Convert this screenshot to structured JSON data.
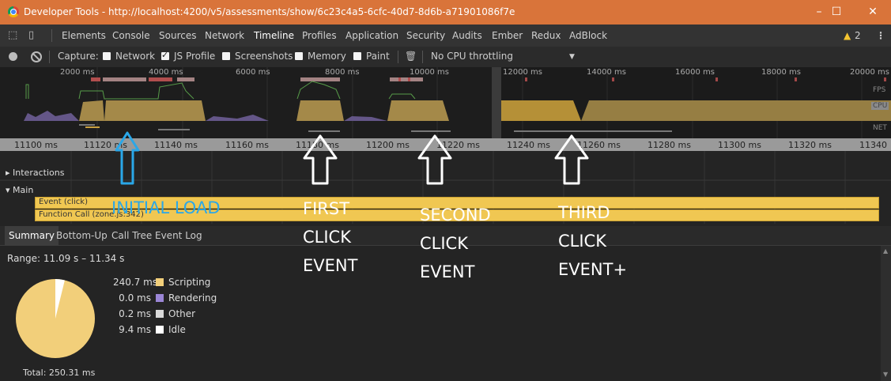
{
  "window": {
    "title": "Developer Tools - http://localhost:4200/v5/assessments/show/6c23c4a5-6cfc-40d7-8d6b-a71901086f7e",
    "controls": [
      "–",
      "☐",
      "✕"
    ]
  },
  "tabs": [
    "Elements",
    "Console",
    "Sources",
    "Network",
    "Timeline",
    "Profiles",
    "Application",
    "Security",
    "Audits",
    "Ember",
    "Redux",
    "AdBlock"
  ],
  "active_tab": "Timeline",
  "warnings": {
    "count": "2"
  },
  "toolbar": {
    "capture_label": "Capture:",
    "options": [
      {
        "label": "Network",
        "checked": false
      },
      {
        "label": "JS Profile",
        "checked": true
      },
      {
        "label": "Screenshots",
        "checked": false
      },
      {
        "label": "Memory",
        "checked": false
      },
      {
        "label": "Paint",
        "checked": false
      }
    ],
    "throttling": "No CPU throttling"
  },
  "overview": {
    "ticks": [
      "2000 ms",
      "4000 ms",
      "6000 ms",
      "8000 ms",
      "10000 ms",
      "12000 ms",
      "14000 ms",
      "16000 ms",
      "18000 ms",
      "20000 ms"
    ],
    "labels": {
      "fps": "FPS",
      "cpu": "CPU",
      "net": "NET"
    }
  },
  "ruler": {
    "ticks": [
      "11100 ms",
      "11120 ms",
      "11140 ms",
      "11160 ms",
      "11180 ms",
      "11200 ms",
      "11220 ms",
      "11240 ms",
      "11260 ms",
      "11280 ms",
      "11300 ms",
      "11320 ms",
      "11340"
    ]
  },
  "flame": {
    "interactions": "Interactions",
    "main": "Main",
    "event": "Event (click)",
    "function_call": "Function Call (zone.js:342)"
  },
  "bottom_tabs": [
    "Summary",
    "Bottom-Up",
    "Call Tree",
    "Event Log"
  ],
  "summary": {
    "range": "Range: 11.09 s – 11.34 s",
    "items": [
      {
        "value": "240.7 ms",
        "label": "Scripting",
        "color": "#f2cf7a"
      },
      {
        "value": "0.0 ms",
        "label": "Rendering",
        "color": "#9b86d6"
      },
      {
        "value": "0.2 ms",
        "label": "Other",
        "color": "#d9d9d9"
      },
      {
        "value": "9.4 ms",
        "label": "Idle",
        "color": "#ffffff"
      }
    ],
    "total": "Total: 250.31 ms",
    "pie": {
      "scripting_ms": 240.7,
      "idle_ms": 9.4,
      "other_ms": 0.2,
      "total_ms": 250.31
    }
  },
  "annotations": {
    "initial_load": "INITIAL LOAD",
    "first": [
      "FIRST",
      "CLICK",
      "EVENT"
    ],
    "second": [
      "SECOND",
      "CLICK",
      "EVENT"
    ],
    "third": [
      "THIRD",
      "CLICK",
      "EVENT+"
    ]
  },
  "colors": {
    "titlebar": "#d9743a",
    "cpu_fill": "#c8a85a",
    "scripting": "#f2cf7a",
    "annotation_blue": "#2aa7e8"
  }
}
